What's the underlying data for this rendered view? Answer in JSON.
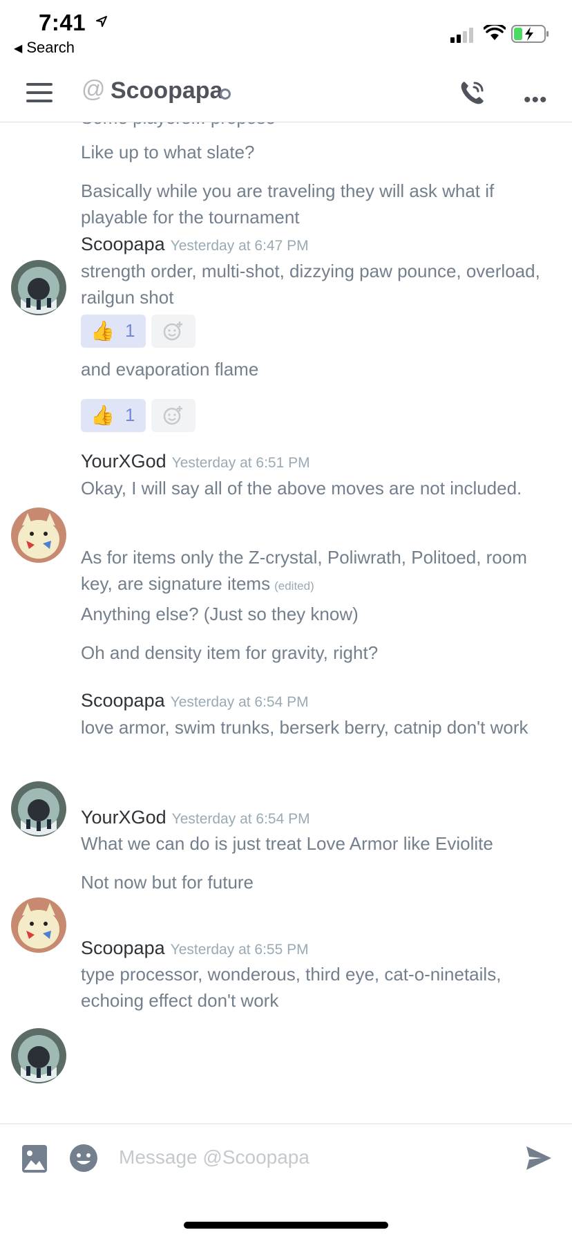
{
  "status_bar": {
    "time": "7:41",
    "back_label": "Search"
  },
  "header": {
    "channel_title": "Scoopapa"
  },
  "messages": {
    "top_cut": "Some players... propose",
    "top_lines": [
      "Like up to what slate?",
      "Basically while you are traveling they will ask what if playable for the tournament"
    ],
    "groups": [
      {
        "author": "Scoopapa",
        "timestamp": "Yesterday at 6:47 PM",
        "lines": [
          "strength order, multi-shot, dizzying paw pounce, overload, railgun shot",
          "and evaporation flame"
        ],
        "reactions": [
          {
            "emoji": "👍",
            "count": "1"
          },
          {
            "emoji": "👍",
            "count": "1"
          }
        ]
      },
      {
        "author": "YourXGod",
        "timestamp": "Yesterday at 6:51 PM",
        "lines": [
          "Okay, I will say all of the above moves are not included.",
          "As for items only the Z-crystal, Poliwrath, Politoed, room key, are signature items",
          "Anything else? (Just so they know)",
          "Oh and density item for gravity, right?"
        ],
        "edited": "(edited)"
      },
      {
        "author": "Scoopapa",
        "timestamp": "Yesterday at 6:54 PM",
        "lines": [
          "love armor, swim trunks, berserk berry, catnip don't work"
        ]
      },
      {
        "author": "YourXGod",
        "timestamp": "Yesterday at 6:54 PM",
        "lines": [
          "What we can do is just treat Love Armor like Eviolite",
          "Not now but for future"
        ]
      },
      {
        "author": "Scoopapa",
        "timestamp": "Yesterday at 6:55 PM",
        "lines": [
          "type processor, wonderous, third eye, cat-o-ninetails, echoing effect don't work"
        ]
      }
    ]
  },
  "composer": {
    "placeholder": "Message @Scoopapa",
    "value": ""
  },
  "colors": {
    "blurple": "#7289da",
    "reaction_bg": "#dfe4f7",
    "muted_text": "#737f8d",
    "timestamp": "#99aab5"
  },
  "icons": {
    "menu": "hamburger-menu-icon",
    "at": "at-icon",
    "call": "phone-call-icon",
    "more": "more-options-icon",
    "image": "image-upload-icon",
    "emoji": "emoji-icon",
    "send": "send-icon"
  }
}
